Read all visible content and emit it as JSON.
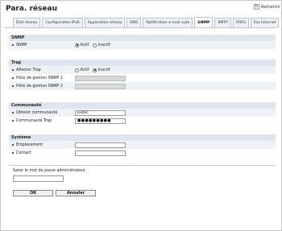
{
  "header": {
    "title": "Para. réseau",
    "refresh_label": "Rafraîchir",
    "refresh_glyph": "↻"
  },
  "tabs": [
    {
      "label": "État réseau",
      "active": false
    },
    {
      "label": "Configuration IPv6",
      "active": false
    },
    {
      "label": "Application réseau",
      "active": false
    },
    {
      "label": "DNS",
      "active": false
    },
    {
      "label": "Notification e-mail auto",
      "active": false
    },
    {
      "label": "SNMP",
      "active": true
    },
    {
      "label": "SMTP",
      "active": false
    },
    {
      "label": "POP3",
      "active": false
    },
    {
      "label": "Fax Internet",
      "active": false
    }
  ],
  "sections": {
    "snmp": {
      "title": "SNMP",
      "rows": [
        {
          "label": "SNMP",
          "options": [
            "Actif",
            "Inactif"
          ],
          "selected": 0
        }
      ]
    },
    "trap": {
      "title": "Trap",
      "affecter": {
        "label": "Affecter Trap",
        "options": [
          "Actif",
          "Inactif"
        ],
        "selected": 1
      },
      "host1": {
        "label": "Hôte de gestion SNMP 1",
        "value": ""
      },
      "host2": {
        "label": "Hôte de gestion SNMP 2",
        "value": ""
      }
    },
    "community": {
      "title": "Communauté",
      "get": {
        "label": "Obtenir communauté",
        "value": "public"
      },
      "trap": {
        "label": "Communauté Trap",
        "value": "●●●●●●●●●"
      }
    },
    "system": {
      "title": "Système",
      "location": {
        "label": "Emplacement",
        "value": ""
      },
      "contact": {
        "label": "Contact",
        "value": ""
      }
    }
  },
  "admin": {
    "label": "Saisir le mot de passe administrateur.",
    "value": ""
  },
  "buttons": {
    "ok": "OK",
    "cancel": "Annuler"
  }
}
